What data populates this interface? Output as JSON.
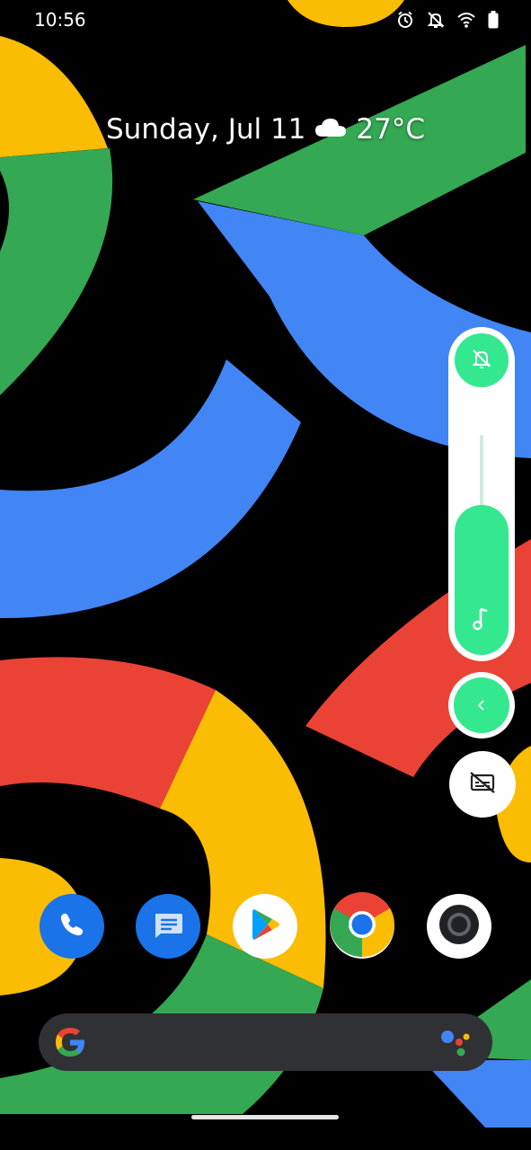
{
  "status_bar": {
    "time": "10:56",
    "icons": [
      "alarm-icon",
      "notifications-off-icon",
      "wifi-icon",
      "battery-icon"
    ]
  },
  "at_a_glance": {
    "date": "Sunday, Jul 11",
    "weather_icon": "cloud-icon",
    "temperature": "27°C"
  },
  "volume_panel": {
    "ringer_mode_icon": "notifications-off-icon",
    "media_volume_icon": "music-note-icon",
    "media_volume_level": 0.68,
    "expand_icon": "chevron-left-icon",
    "caption_icon": "captions-off-icon",
    "accent_color": "#34e890"
  },
  "dock": {
    "apps": [
      "phone",
      "messages",
      "play-store",
      "chrome",
      "camera"
    ]
  },
  "search_bar": {
    "logo_icon": "google-g-icon",
    "assistant_icon": "google-assistant-icon"
  },
  "wallpaper": {
    "colors": [
      "#34a853",
      "#4285f4",
      "#ea4335",
      "#fbbc04"
    ]
  }
}
